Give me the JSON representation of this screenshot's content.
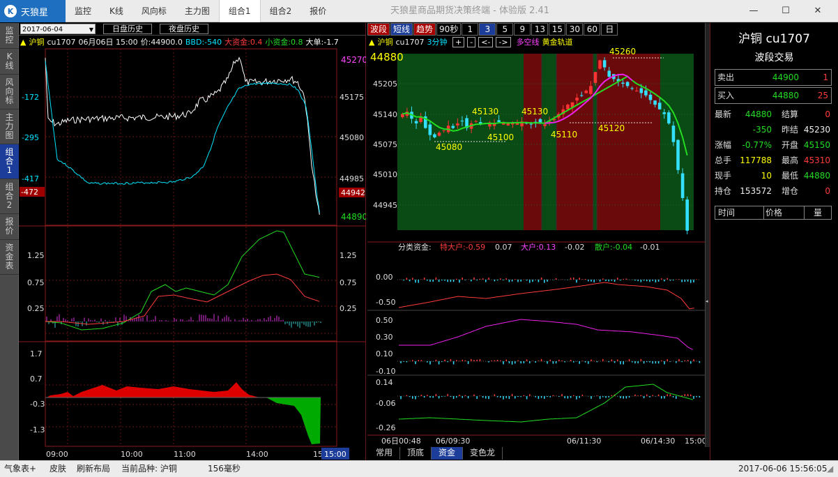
{
  "app": {
    "logo": "天狼星",
    "title": "天狼星商品期货决策终端 - 体验版 2.41"
  },
  "menu": [
    "监控",
    "K线",
    "风向标",
    "主力图",
    "组合1",
    "组合2",
    "报价"
  ],
  "menu_active": 4,
  "sidetabs": [
    "监控",
    "K线",
    "风向标",
    "主力图",
    "组合1",
    "组合2",
    "报价",
    "资金表"
  ],
  "sidetab_active": 4,
  "left": {
    "date": "2017-06-04",
    "day_btn": "日盘历史",
    "night_btn": "夜盘历史",
    "info": {
      "sym": "沪铜",
      "code": "cu1707",
      "datetime": "06月06日 15:00",
      "price": "价:44900.0",
      "bbd": "BBD:-540",
      "big": "大资金:0.4",
      "small": "小资金:0.8",
      "bigorder": "大单:-1.7"
    },
    "main_left_ticks": [
      "-172",
      "-295",
      "-417"
    ],
    "main_left_marker": "-472",
    "main_right_ticks": [
      "45175",
      "45080",
      "44985"
    ],
    "main_top_price": "45270",
    "main_marker_price": "44942",
    "main_bottom_price": "44890",
    "ind_ticks": [
      "1.25",
      "0.75",
      "0.25"
    ],
    "money_ticks": [
      "1.7",
      "0.7",
      "-0.3",
      "-1.3"
    ],
    "time_ticks": [
      "09:00",
      "10:00",
      "11:00",
      "14:00",
      "15:"
    ],
    "time_end": "15:00"
  },
  "right": {
    "tabs": [
      "波段",
      "短线",
      "趋势",
      "90秒",
      "1",
      "3",
      "5",
      "9",
      "13",
      "15",
      "30",
      "60",
      "日"
    ],
    "tab_red": [
      0,
      2
    ],
    "tab_blue": [
      1,
      5
    ],
    "info": {
      "sym": "沪铜",
      "code": "cu1707",
      "period": "3分钟",
      "btns": [
        "+",
        "-",
        "<-",
        "->"
      ],
      "multi": "多空线",
      "gold": "黄金轨道"
    },
    "price_big": "44880",
    "yticks": [
      "45205",
      "45140",
      "45075",
      "45010",
      "44945"
    ],
    "annotations": [
      "45260",
      "45130",
      "45130",
      "45080",
      "45100",
      "45110",
      "45120"
    ],
    "fund_header": {
      "label": "分类资金:",
      "te": "特大户:-0.59",
      "te2": "0.07",
      "da": "大户:0.13",
      "da2": "-0.02",
      "san": "散户:-0.04",
      "san2": "-0.01"
    },
    "p1_ticks": [
      "0.00",
      "-0.50"
    ],
    "p2_ticks": [
      "0.50",
      "0.30",
      "0.10",
      "-0.10"
    ],
    "p3_ticks": [
      "0.14",
      "-0.06",
      "-0.26"
    ],
    "xticks": [
      "06日00:48",
      "06/09:30",
      "06/11:30",
      "06/14:30",
      "15:00"
    ],
    "bottom_tabs": [
      "常用",
      "顶底",
      "资金",
      "变色龙"
    ],
    "bottom_active": 2
  },
  "quote": {
    "title": "沪铜 cu1707",
    "subtitle": "波段交易",
    "sell": {
      "label": "卖出",
      "price": "44900",
      "vol": "1"
    },
    "buy": {
      "label": "买入",
      "price": "44880",
      "vol": "25"
    },
    "stats": [
      {
        "a": "最新",
        "b": "44880",
        "bc": "#22dd22",
        "c": "结算",
        "d": "0",
        "dc": "#ff3b3b"
      },
      {
        "a": "",
        "b": "-350",
        "bc": "#22dd22",
        "c": "昨结",
        "d": "45230",
        "dc": "#eeeeee"
      },
      {
        "a": "涨幅",
        "b": "-0.77%",
        "bc": "#22dd22",
        "c": "开盘",
        "d": "45150",
        "dc": "#22dd22"
      },
      {
        "a": "总手",
        "b": "117788",
        "bc": "#ffff00",
        "c": "最高",
        "d": "45310",
        "dc": "#ff3b3b"
      },
      {
        "a": "现手",
        "b": "10",
        "bc": "#ffff00",
        "c": "最低",
        "d": "44880",
        "dc": "#22dd22"
      },
      {
        "a": "持仓",
        "b": "153572",
        "bc": "#eeeeee",
        "c": "增仓",
        "d": "0",
        "dc": "#ff3b3b"
      }
    ],
    "table_headers": [
      "时间",
      "价格",
      "量"
    ]
  },
  "status": {
    "items": [
      "气象表+",
      "皮肤",
      "刷新布局",
      "当前品种: 沪铜",
      "156毫秒"
    ],
    "datetime": "2017-06-06 15:56:05"
  }
}
